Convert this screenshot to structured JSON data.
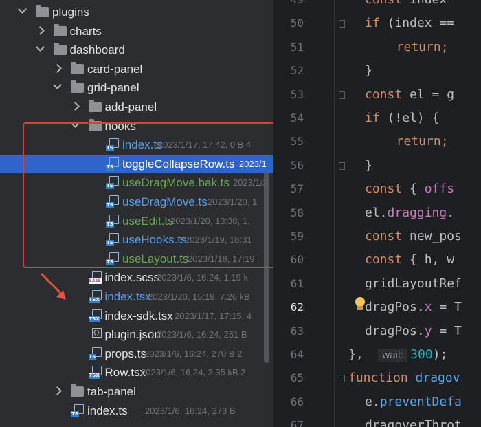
{
  "tree": {
    "rows": [
      {
        "id": "plugins",
        "label": "plugins",
        "meta": "",
        "color": "default",
        "kind": "folder",
        "open": true
      },
      {
        "id": "charts",
        "label": "charts",
        "meta": "",
        "color": "default",
        "kind": "folder",
        "open": false
      },
      {
        "id": "dashboard",
        "label": "dashboard",
        "meta": "",
        "color": "default",
        "kind": "folder",
        "open": true
      },
      {
        "id": "card-panel",
        "label": "card-panel",
        "meta": "",
        "color": "default",
        "kind": "folder",
        "open": false
      },
      {
        "id": "grid-panel",
        "label": "grid-panel",
        "meta": "",
        "color": "default",
        "kind": "folder",
        "open": true
      },
      {
        "id": "add-panel",
        "label": "add-panel",
        "meta": "",
        "color": "default",
        "kind": "folder",
        "open": false
      },
      {
        "id": "hooks",
        "label": "hooks",
        "meta": "",
        "color": "default",
        "kind": "folder",
        "open": true
      },
      {
        "id": "index-ts",
        "label": "index.ts",
        "meta": "2023/1/17, 17:42, 0 B 4",
        "color": "blue",
        "kind": "ts"
      },
      {
        "id": "toggle",
        "label": "toggleCollapseRow.ts",
        "meta": "2023/1",
        "color": "default",
        "kind": "ts",
        "selected": true
      },
      {
        "id": "dragmove-bak",
        "label": "useDragMove.bak.ts",
        "meta": "2023/1/2",
        "color": "green",
        "kind": "ts"
      },
      {
        "id": "dragmove",
        "label": "useDragMove.ts",
        "meta": "2023/1/20, 1",
        "color": "blue",
        "kind": "ts"
      },
      {
        "id": "useedit",
        "label": "useEdit.ts",
        "meta": "2023/1/20, 13:38, 1.",
        "color": "green",
        "kind": "ts"
      },
      {
        "id": "usehooks",
        "label": "useHooks.ts",
        "meta": "2023/1/19, 18:31",
        "color": "blue",
        "kind": "ts"
      },
      {
        "id": "uselayout",
        "label": "useLayout.ts",
        "meta": "2023/1/18, 17:19",
        "color": "green",
        "kind": "ts"
      },
      {
        "id": "index-scss",
        "label": "index.scss",
        "meta": "2023/1/6, 16:24, 1.19 k",
        "color": "default",
        "kind": "sass"
      },
      {
        "id": "index-tsx",
        "label": "index.tsx",
        "meta": "2023/1/20, 15:19, 7.26 kB",
        "color": "blue",
        "kind": "tsx"
      },
      {
        "id": "index-sdk",
        "label": "index-sdk.tsx",
        "meta": "2023/1/17, 17:15, 4",
        "color": "default",
        "kind": "tsx"
      },
      {
        "id": "plugin-json",
        "label": "plugin.json",
        "meta": "2023/1/6, 16:24, 251 B",
        "color": "default",
        "kind": "json"
      },
      {
        "id": "props-ts",
        "label": "props.ts",
        "meta": "2023/1/6, 16:24, 270 B 2",
        "color": "default",
        "kind": "ts"
      },
      {
        "id": "row-tsx",
        "label": "Row.tsx",
        "meta": "2023/1/6, 16:24, 3.35 kB 2",
        "color": "default",
        "kind": "tsx"
      },
      {
        "id": "tab-panel",
        "label": "tab-panel",
        "meta": "",
        "color": "default",
        "kind": "folder",
        "open": false
      },
      {
        "id": "index-ts2",
        "label": "index.ts",
        "meta": "2023/1/6, 16:24, 273 B",
        "color": "default",
        "kind": "ts"
      }
    ],
    "badges": {
      "ts": "TS",
      "tsx": "TSX",
      "sass": "SASS"
    }
  },
  "editor": {
    "line_numbers": [
      "49",
      "50",
      "51",
      "52",
      "53",
      "54",
      "55",
      "56",
      "57",
      "58",
      "59",
      "60",
      "61",
      "62",
      "63",
      "64",
      "65",
      "66",
      "67"
    ],
    "current_line": "62",
    "hint_label": "wait:",
    "lines": [
      [
        {
          "t": "const ",
          "c": "k"
        },
        {
          "t": "index ",
          "c": ""
        }
      ],
      [
        {
          "t": "if ",
          "c": "k"
        },
        {
          "t": "(index ==",
          "c": ""
        }
      ],
      [
        {
          "t": "  return;",
          "c": "k"
        }
      ],
      [
        {
          "t": "}",
          "c": ""
        }
      ],
      [
        {
          "t": "const ",
          "c": "k"
        },
        {
          "t": "el = g",
          "c": ""
        }
      ],
      [
        {
          "t": "if ",
          "c": "k"
        },
        {
          "t": "(!el) {",
          "c": ""
        }
      ],
      [
        {
          "t": "  return;",
          "c": "k"
        }
      ],
      [
        {
          "t": "}",
          "c": ""
        }
      ],
      [
        {
          "t": "const ",
          "c": "k"
        },
        {
          "t": "{ ",
          "c": ""
        },
        {
          "t": "offs",
          "c": "v"
        }
      ],
      [
        {
          "t": "el.",
          "c": ""
        },
        {
          "t": "dragging",
          "c": "v"
        },
        {
          "t": ".",
          "c": ""
        }
      ],
      [
        {
          "t": "const ",
          "c": "k"
        },
        {
          "t": "new_pos",
          "c": ""
        }
      ],
      [
        {
          "t": "const ",
          "c": "k"
        },
        {
          "t": "{ h, w",
          "c": ""
        }
      ],
      [
        {
          "t": "gridLayoutRef",
          "c": ""
        }
      ],
      [
        {
          "t": "dragPos.",
          "c": ""
        },
        {
          "t": "x",
          "c": "v"
        },
        {
          "t": " = T",
          "c": ""
        }
      ],
      [
        {
          "t": "dragPos.",
          "c": ""
        },
        {
          "t": "y",
          "c": "v"
        },
        {
          "t": " = T",
          "c": ""
        }
      ],
      [
        {
          "t": "},  ",
          "c": ""
        },
        {
          "t": "HINT",
          "c": "hint"
        },
        {
          "t": "300",
          "c": "n"
        },
        {
          "t": ");",
          "c": ""
        }
      ],
      [
        {
          "t": "function ",
          "c": "k"
        },
        {
          "t": "dragov",
          "c": "f"
        }
      ],
      [
        {
          "t": "e.",
          "c": ""
        },
        {
          "t": "preventDefa",
          "c": "f"
        }
      ],
      [
        {
          "t": "dragoverThrot",
          "c": ""
        }
      ]
    ],
    "indent": [
      1,
      1,
      2,
      1,
      1,
      1,
      2,
      1,
      1,
      1,
      1,
      1,
      1,
      1,
      1,
      0,
      0,
      1,
      1
    ]
  }
}
